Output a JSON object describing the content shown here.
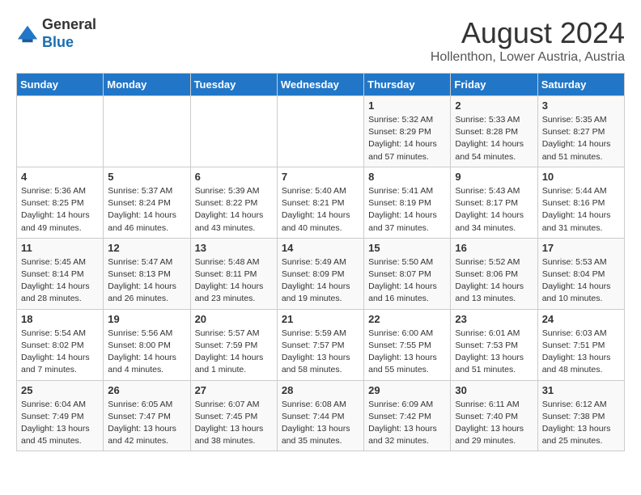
{
  "header": {
    "logo_line1": "General",
    "logo_line2": "Blue",
    "title": "August 2024",
    "subtitle": "Hollenthon, Lower Austria, Austria"
  },
  "weekdays": [
    "Sunday",
    "Monday",
    "Tuesday",
    "Wednesday",
    "Thursday",
    "Friday",
    "Saturday"
  ],
  "weeks": [
    [
      {
        "day": "",
        "detail": ""
      },
      {
        "day": "",
        "detail": ""
      },
      {
        "day": "",
        "detail": ""
      },
      {
        "day": "",
        "detail": ""
      },
      {
        "day": "1",
        "detail": "Sunrise: 5:32 AM\nSunset: 8:29 PM\nDaylight: 14 hours\nand 57 minutes."
      },
      {
        "day": "2",
        "detail": "Sunrise: 5:33 AM\nSunset: 8:28 PM\nDaylight: 14 hours\nand 54 minutes."
      },
      {
        "day": "3",
        "detail": "Sunrise: 5:35 AM\nSunset: 8:27 PM\nDaylight: 14 hours\nand 51 minutes."
      }
    ],
    [
      {
        "day": "4",
        "detail": "Sunrise: 5:36 AM\nSunset: 8:25 PM\nDaylight: 14 hours\nand 49 minutes."
      },
      {
        "day": "5",
        "detail": "Sunrise: 5:37 AM\nSunset: 8:24 PM\nDaylight: 14 hours\nand 46 minutes."
      },
      {
        "day": "6",
        "detail": "Sunrise: 5:39 AM\nSunset: 8:22 PM\nDaylight: 14 hours\nand 43 minutes."
      },
      {
        "day": "7",
        "detail": "Sunrise: 5:40 AM\nSunset: 8:21 PM\nDaylight: 14 hours\nand 40 minutes."
      },
      {
        "day": "8",
        "detail": "Sunrise: 5:41 AM\nSunset: 8:19 PM\nDaylight: 14 hours\nand 37 minutes."
      },
      {
        "day": "9",
        "detail": "Sunrise: 5:43 AM\nSunset: 8:17 PM\nDaylight: 14 hours\nand 34 minutes."
      },
      {
        "day": "10",
        "detail": "Sunrise: 5:44 AM\nSunset: 8:16 PM\nDaylight: 14 hours\nand 31 minutes."
      }
    ],
    [
      {
        "day": "11",
        "detail": "Sunrise: 5:45 AM\nSunset: 8:14 PM\nDaylight: 14 hours\nand 28 minutes."
      },
      {
        "day": "12",
        "detail": "Sunrise: 5:47 AM\nSunset: 8:13 PM\nDaylight: 14 hours\nand 26 minutes."
      },
      {
        "day": "13",
        "detail": "Sunrise: 5:48 AM\nSunset: 8:11 PM\nDaylight: 14 hours\nand 23 minutes."
      },
      {
        "day": "14",
        "detail": "Sunrise: 5:49 AM\nSunset: 8:09 PM\nDaylight: 14 hours\nand 19 minutes."
      },
      {
        "day": "15",
        "detail": "Sunrise: 5:50 AM\nSunset: 8:07 PM\nDaylight: 14 hours\nand 16 minutes."
      },
      {
        "day": "16",
        "detail": "Sunrise: 5:52 AM\nSunset: 8:06 PM\nDaylight: 14 hours\nand 13 minutes."
      },
      {
        "day": "17",
        "detail": "Sunrise: 5:53 AM\nSunset: 8:04 PM\nDaylight: 14 hours\nand 10 minutes."
      }
    ],
    [
      {
        "day": "18",
        "detail": "Sunrise: 5:54 AM\nSunset: 8:02 PM\nDaylight: 14 hours\nand 7 minutes."
      },
      {
        "day": "19",
        "detail": "Sunrise: 5:56 AM\nSunset: 8:00 PM\nDaylight: 14 hours\nand 4 minutes."
      },
      {
        "day": "20",
        "detail": "Sunrise: 5:57 AM\nSunset: 7:59 PM\nDaylight: 14 hours\nand 1 minute."
      },
      {
        "day": "21",
        "detail": "Sunrise: 5:59 AM\nSunset: 7:57 PM\nDaylight: 13 hours\nand 58 minutes."
      },
      {
        "day": "22",
        "detail": "Sunrise: 6:00 AM\nSunset: 7:55 PM\nDaylight: 13 hours\nand 55 minutes."
      },
      {
        "day": "23",
        "detail": "Sunrise: 6:01 AM\nSunset: 7:53 PM\nDaylight: 13 hours\nand 51 minutes."
      },
      {
        "day": "24",
        "detail": "Sunrise: 6:03 AM\nSunset: 7:51 PM\nDaylight: 13 hours\nand 48 minutes."
      }
    ],
    [
      {
        "day": "25",
        "detail": "Sunrise: 6:04 AM\nSunset: 7:49 PM\nDaylight: 13 hours\nand 45 minutes."
      },
      {
        "day": "26",
        "detail": "Sunrise: 6:05 AM\nSunset: 7:47 PM\nDaylight: 13 hours\nand 42 minutes."
      },
      {
        "day": "27",
        "detail": "Sunrise: 6:07 AM\nSunset: 7:45 PM\nDaylight: 13 hours\nand 38 minutes."
      },
      {
        "day": "28",
        "detail": "Sunrise: 6:08 AM\nSunset: 7:44 PM\nDaylight: 13 hours\nand 35 minutes."
      },
      {
        "day": "29",
        "detail": "Sunrise: 6:09 AM\nSunset: 7:42 PM\nDaylight: 13 hours\nand 32 minutes."
      },
      {
        "day": "30",
        "detail": "Sunrise: 6:11 AM\nSunset: 7:40 PM\nDaylight: 13 hours\nand 29 minutes."
      },
      {
        "day": "31",
        "detail": "Sunrise: 6:12 AM\nSunset: 7:38 PM\nDaylight: 13 hours\nand 25 minutes."
      }
    ]
  ]
}
